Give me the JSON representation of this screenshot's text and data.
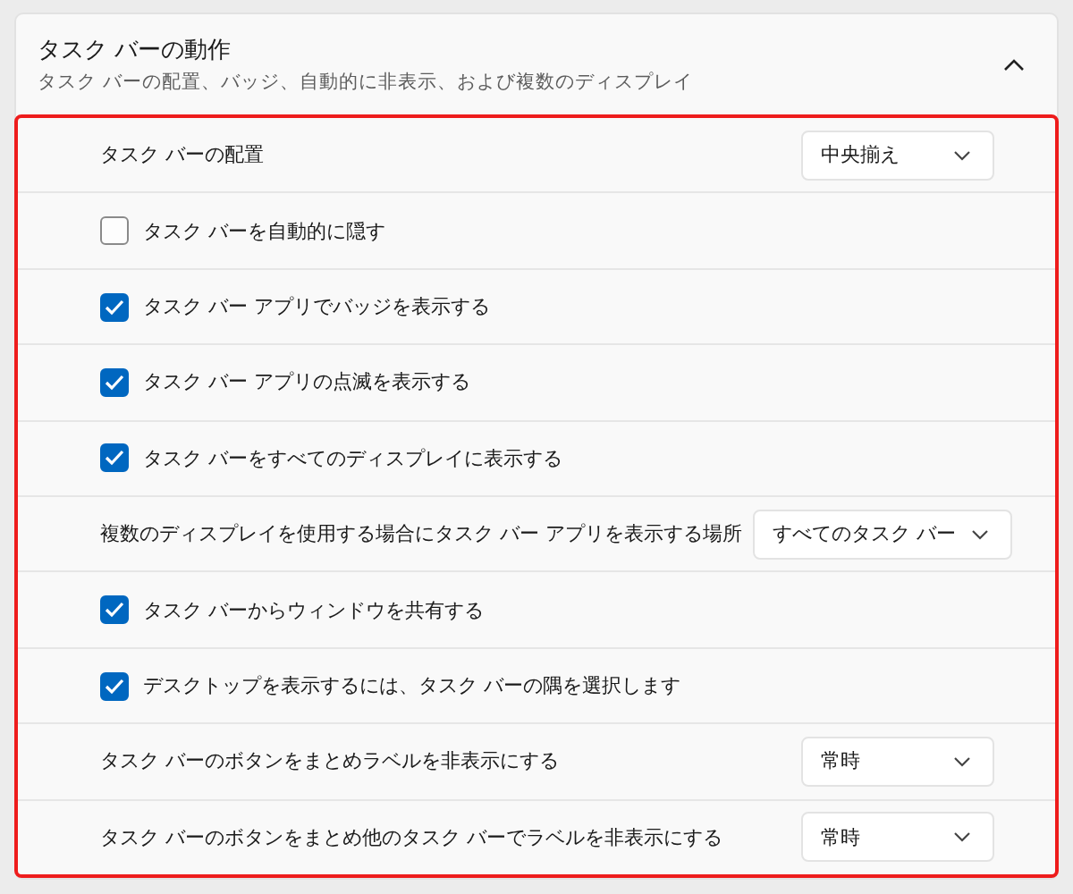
{
  "section": {
    "title": "タスク バーの動作",
    "subtitle": "タスク バーの配置、バッジ、自動的に非表示、および複数のディスプレイ",
    "expanded": true
  },
  "settings": [
    {
      "kind": "dropdown",
      "label": "タスク バーの配置",
      "value": "中央揃え"
    },
    {
      "kind": "checkbox",
      "label": "タスク バーを自動的に隠す",
      "checked": false
    },
    {
      "kind": "checkbox",
      "label": "タスク バー アプリでバッジを表示する",
      "checked": true
    },
    {
      "kind": "checkbox",
      "label": "タスク バー アプリの点滅を表示する",
      "checked": true
    },
    {
      "kind": "checkbox",
      "label": "タスク バーをすべてのディスプレイに表示する",
      "checked": true
    },
    {
      "kind": "dropdown",
      "label": "複数のディスプレイを使用する場合にタスク バー アプリを表示する場所",
      "value": "すべてのタスク バー"
    },
    {
      "kind": "checkbox",
      "label": "タスク バーからウィンドウを共有する",
      "checked": true
    },
    {
      "kind": "checkbox",
      "label": "デスクトップを表示するには、タスク バーの隅を選択します",
      "checked": true
    },
    {
      "kind": "dropdown",
      "label": "タスク バーのボタンをまとめラベルを非表示にする",
      "value": "常時"
    },
    {
      "kind": "dropdown",
      "label": "タスク バーのボタンをまとめ他のタスク バーでラベルを非表示にする",
      "value": "常時"
    }
  ]
}
